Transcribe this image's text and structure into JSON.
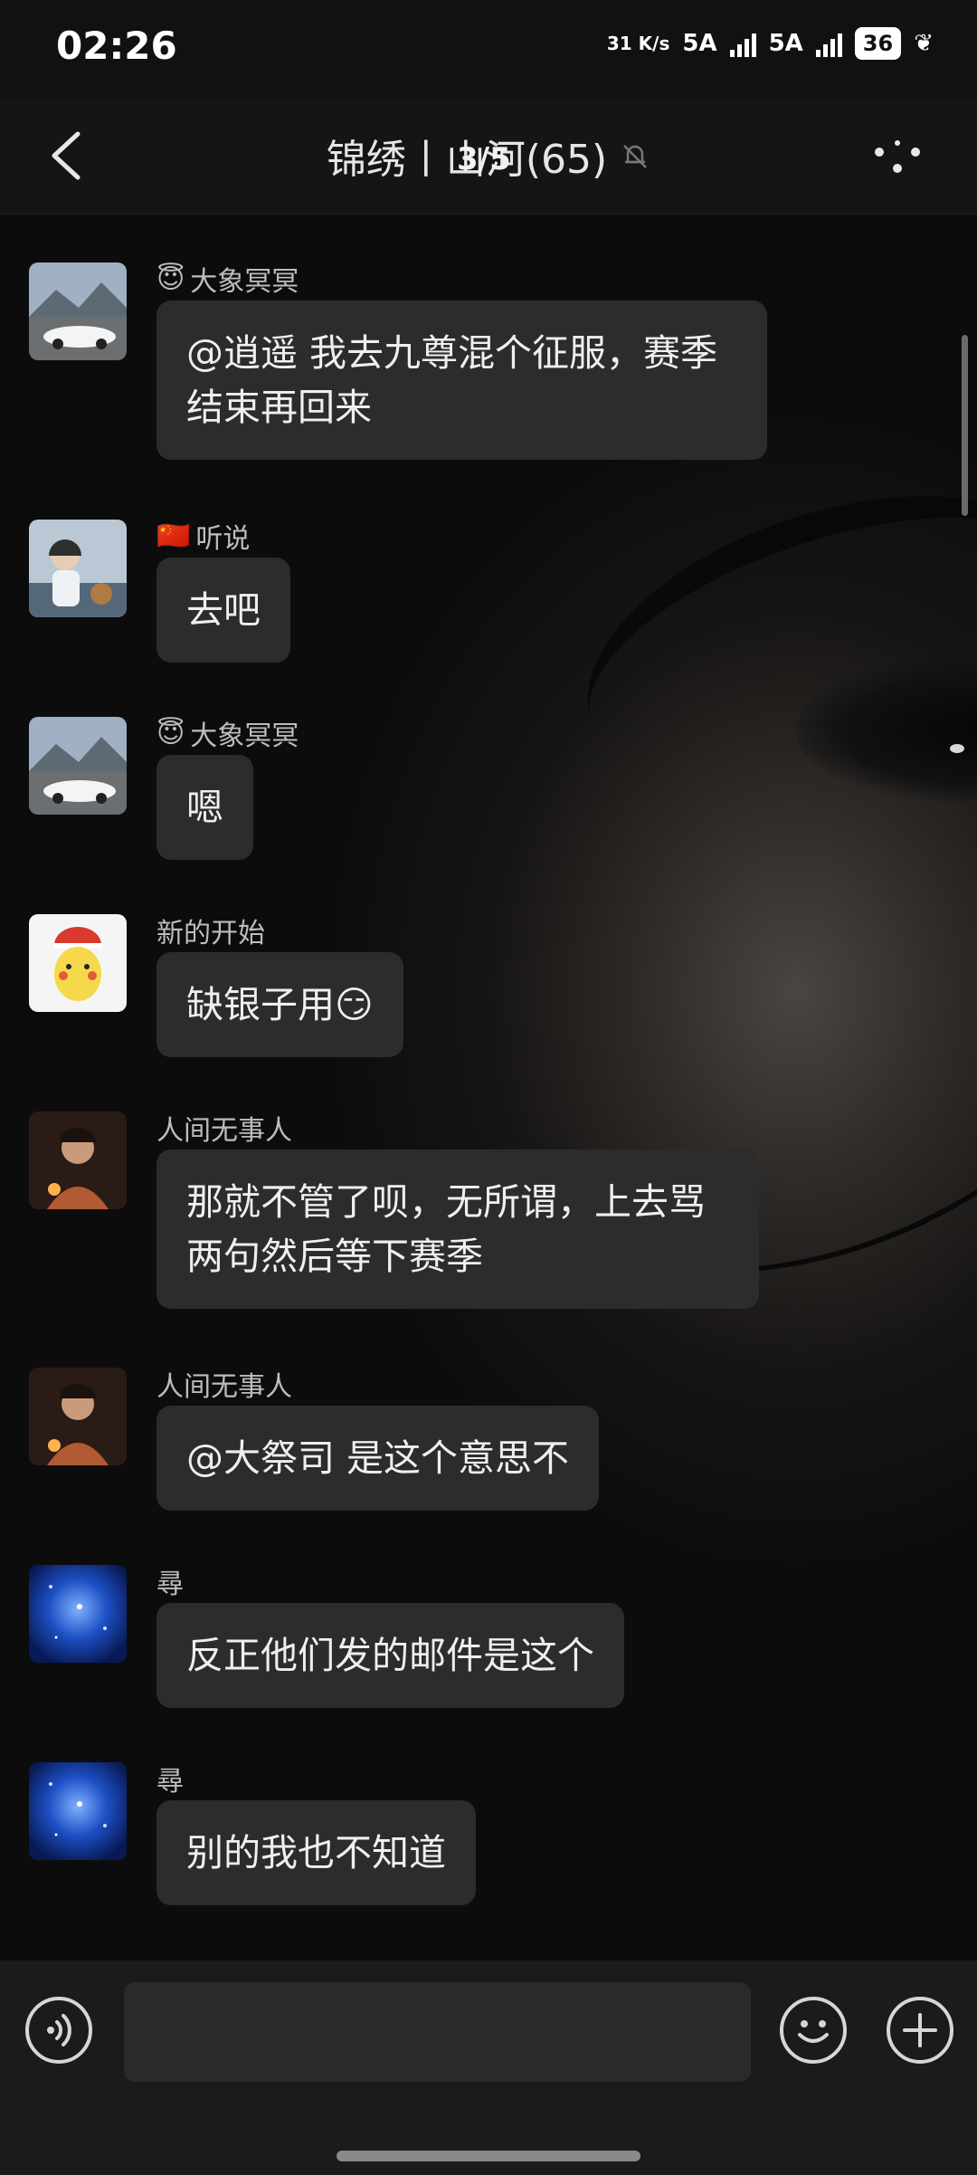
{
  "status": {
    "time": "02:26",
    "net_speed": "31 K/s",
    "sim1": "5A",
    "sim2": "5A",
    "battery": "36"
  },
  "header": {
    "title": "锦绣丨山河(65)",
    "pager": "3/5",
    "mute_icon": "bell-off-icon"
  },
  "messages": [
    {
      "sender": "大象冥冥",
      "badge": "😇",
      "text": "@逍遥 我去九尊混个征服，赛季结束再回来",
      "avatar": "car"
    },
    {
      "sender": "听说",
      "badge": "🇨🇳",
      "text": "去吧",
      "avatar": "boy"
    },
    {
      "sender": "大象冥冥",
      "badge": "😇",
      "text": "嗯",
      "avatar": "car"
    },
    {
      "sender": "新的开始",
      "badge": "",
      "text": "缺银子用😏",
      "avatar": "pikachu"
    },
    {
      "sender": "人间无事人",
      "badge": "",
      "text": "那就不管了呗，无所谓，上去骂两句然后等下赛季",
      "avatar": "man"
    },
    {
      "sender": "人间无事人",
      "badge": "",
      "text": "@大祭司 是这个意思不",
      "avatar": "man"
    },
    {
      "sender": "尋",
      "badge": "",
      "text": "反正他们发的邮件是这个",
      "avatar": "stars"
    },
    {
      "sender": "尋",
      "badge": "",
      "text": "别的我也不知道",
      "avatar": "stars"
    }
  ],
  "input": {
    "placeholder": ""
  },
  "colors": {
    "bubble": "#2c2c2c",
    "background": "#0b0b0b"
  }
}
